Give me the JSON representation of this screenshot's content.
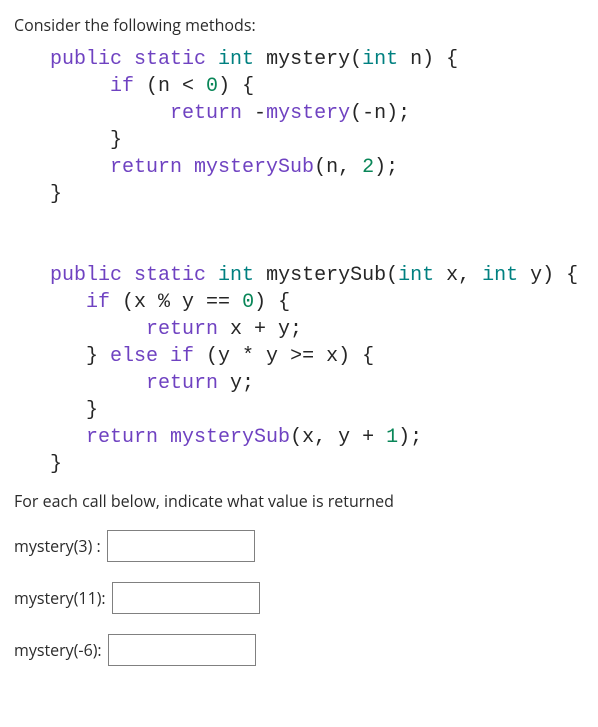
{
  "intro": "Consider the following methods:",
  "code": {
    "m1_sig_lead": "public static ",
    "m1_type": "int",
    "m1_fn": " mystery",
    "m1_sig_tail_a": "(",
    "m1_sig_tail_b": " n) {",
    "m1_if_kw": "if",
    "m1_if_cond_a": " (n < ",
    "m1_if_cond_b": ") {",
    "m1_return_kw": "return",
    "m1_return_expr_a": " -",
    "m1_return_call": "mystery",
    "m1_return_expr_b": "(-n);",
    "m1_closeif": "}",
    "m1_return2_kw": "return",
    "m1_return2_call": " mysterySub",
    "m1_return2_tail_a": "(n, ",
    "m1_return2_tail_b": ");",
    "m1_close": "}",
    "m2_sig_lead": "public static ",
    "m2_type": "int",
    "m2_fn": " mysterySub",
    "m2_sig_tail_a": "(",
    "m2_sig_tail_b": " x, ",
    "m2_sig_tail_c": " y) {",
    "m2_if_kw": "if",
    "m2_if_cond_a": " (x % y == ",
    "m2_if_cond_b": ") {",
    "m2_return_kw": "return",
    "m2_return_expr": " x + y;",
    "m2_elseif_a": "}",
    "m2_elseif_b": " else if",
    "m2_elseif_c": " (y * y >= x) {",
    "m2_return2_kw": "return",
    "m2_return2_expr": " y;",
    "m2_closeif": "}",
    "m2_return3_kw": "return",
    "m2_return3_call": " mysterySub",
    "m2_return3_tail_a": "(x, y + ",
    "m2_return3_tail_b": ");",
    "m2_close": "}",
    "zero": "0",
    "one": "1",
    "two": "2",
    "int_kw": "int"
  },
  "prompt": "For each call below, indicate what value is returned",
  "answers": [
    {
      "label": "mystery(3) :",
      "value": ""
    },
    {
      "label": "mystery(11):",
      "value": ""
    },
    {
      "label": "mystery(-6):",
      "value": ""
    }
  ]
}
